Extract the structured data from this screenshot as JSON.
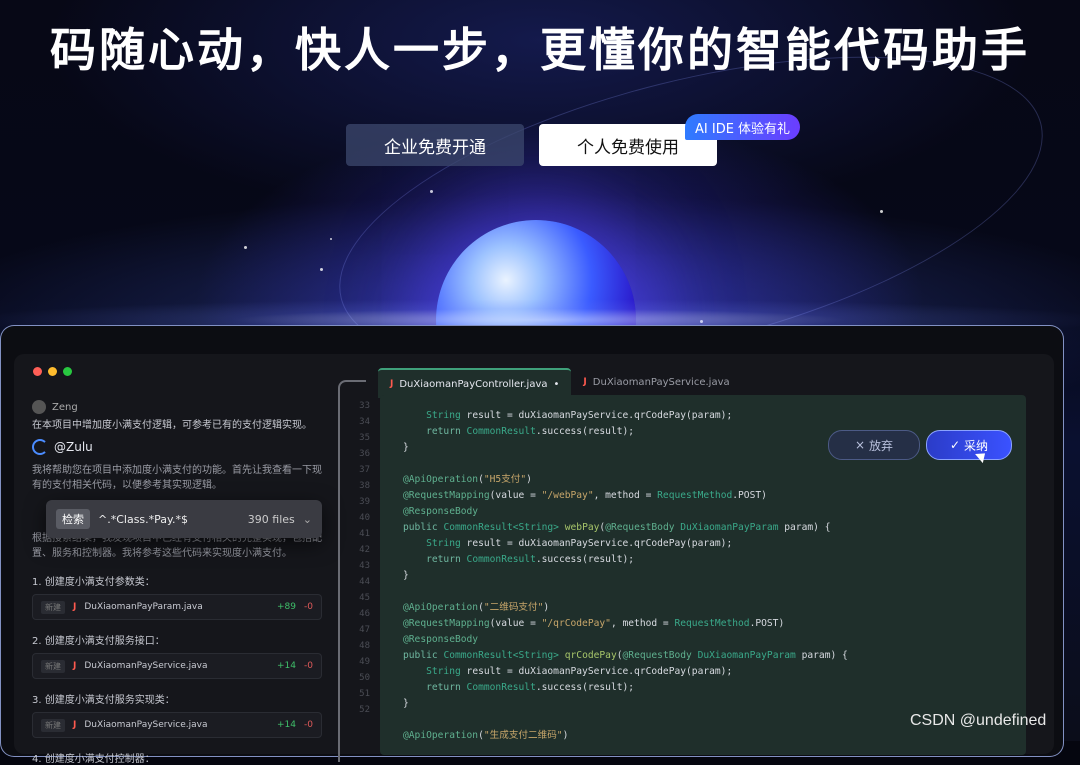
{
  "hero": {
    "headline": "码随心动，快人一步，更懂你的智能代码助手",
    "enterprise_button": "企业免费开通",
    "personal_button": "个人免费使用",
    "badge": "AI IDE 体验有礼"
  },
  "chat": {
    "user_name": "Zeng",
    "user_message": "在本项目中增加度小满支付逻辑，可参考已有的支付逻辑实现。",
    "assistant_name": "@Zulu",
    "assistant_message": "我将帮助您在项目中添加度小满支付的功能。首先让我查看一下现有的支付相关代码，以便参考其实现逻辑。",
    "search_result_note": "根据搜索结果，我发现项目中已经有支付相关的完整实现，包括配置、服务和控制器。我将参考这些代码来实现度小满支付。",
    "search_popup": {
      "tag": "检索",
      "query": "^.*Class.*Pay.*$",
      "count": "390 files"
    },
    "steps": [
      {
        "title": "1. 创建度小满支付参数类：",
        "tag": "新建",
        "file": "DuXiaomanPayParam.java",
        "add": "+89",
        "del": "-0"
      },
      {
        "title": "2. 创建度小满支付服务接口：",
        "tag": "新建",
        "file": "DuXiaomanPayService.java",
        "add": "+14",
        "del": "-0"
      },
      {
        "title": "3. 创建度小满支付服务实现类：",
        "tag": "新建",
        "file": "DuXiaomanPayService.java",
        "add": "+14",
        "del": "-0"
      }
    ],
    "step4_title": "4. 创建度小满支付控制器："
  },
  "editor": {
    "tabs": [
      {
        "label": "DuXiaomanPayController.java",
        "modified": "•"
      },
      {
        "label": "DuXiaomanPayService.java"
      }
    ],
    "line_numbers": [
      "33",
      "34",
      "35",
      "36",
      "37",
      "38",
      "39",
      "40",
      "41",
      "42",
      "43",
      "44",
      "45",
      "46",
      "47",
      "48",
      "49",
      "50",
      "51",
      "52"
    ],
    "reject_label": "放弃",
    "accept_label": "采纳"
  },
  "watermark": "CSDN @undefined"
}
